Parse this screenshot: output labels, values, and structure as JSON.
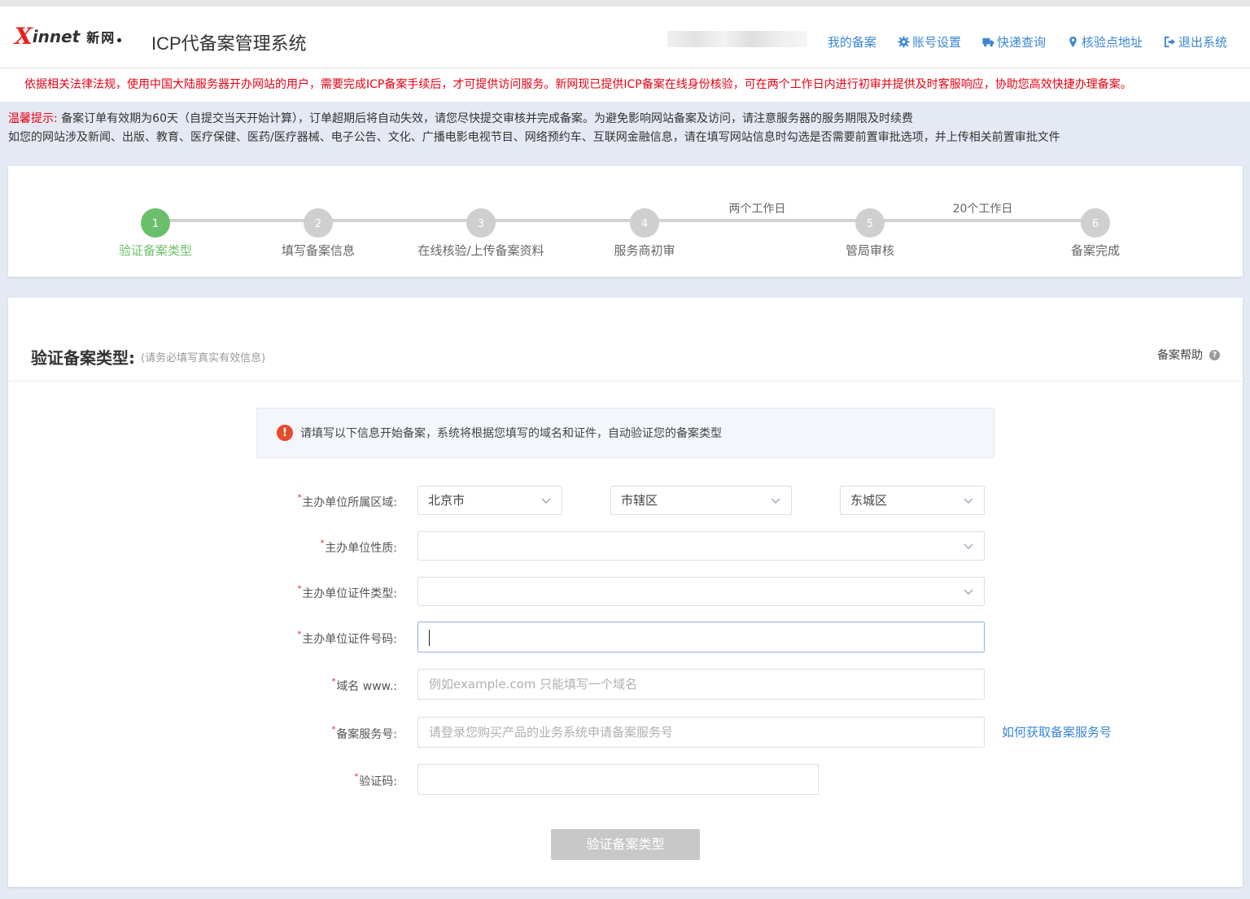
{
  "header": {
    "logo_x": "X",
    "logo_rest": "innet",
    "logo_cn": "新网",
    "title": "ICP代备案管理系统",
    "nav": [
      {
        "label": "我的备案",
        "icon": "none"
      },
      {
        "label": "账号设置",
        "icon": "gear-icon"
      },
      {
        "label": "快递查询",
        "icon": "truck-icon"
      },
      {
        "label": "核验点地址",
        "icon": "map-pin-icon"
      },
      {
        "label": "退出系统",
        "icon": "logout-icon"
      }
    ]
  },
  "notice": "依据相关法律法规，使用中国大陆服务器开办网站的用户，需要完成ICP备案手续后，才可提供访问服务。新网现已提供ICP备案在线身份核验，可在两个工作日内进行初审并提供及时客服响应，协助您高效快捷办理备案。",
  "tips": {
    "label": "温馨提示:",
    "line1": "备案订单有效期为60天（自提交当天开始计算），订单超期后将自动失效，请您尽快提交审核并完成备案。为避免影响网站备案及访问，请注意服务器的服务期限及时续费",
    "line2": "如您的网站涉及新闻、出版、教育、医疗保健、医药/医疗器械、电子公告、文化、广播电影电视节目、网络预约车、互联网金融信息，请在填写网站信息时勾选是否需要前置审批选项，并上传相关前置审批文件"
  },
  "steps": {
    "items": [
      {
        "num": "1",
        "label": "验证备案类型",
        "active": true
      },
      {
        "num": "2",
        "label": "填写备案信息",
        "active": false
      },
      {
        "num": "3",
        "label": "在线核验/上传备案资料",
        "active": false
      },
      {
        "num": "4",
        "label": "服务商初审",
        "active": false
      },
      {
        "num": "5",
        "label": "管局审核",
        "active": false
      },
      {
        "num": "6",
        "label": "备案完成",
        "active": false
      }
    ],
    "durations": [
      "两个工作日",
      "20个工作日"
    ],
    "active_color": "#6cbf6a",
    "inactive_color": "#cfcfcf"
  },
  "form": {
    "title": "验证备案类型:",
    "subtitle": "(请务必填写真实有效信息)",
    "help": "备案帮助",
    "alert": "请填写以下信息开始备案，系统将根据您填写的域名和证件，自动验证您的备案类型",
    "region_label": "主办单位所属区域:",
    "province": "北京市",
    "city": "市辖区",
    "district": "东城区",
    "nature_label": "主办单位性质:",
    "nature_value": "",
    "cert_type_label": "主办单位证件类型:",
    "cert_type_value": "",
    "cert_no_label": "主办单位证件号码:",
    "cert_no_value": "",
    "domain_label": "域名 www.:",
    "domain_placeholder": "例如example.com 只能填写一个域名",
    "service_label": "备案服务号:",
    "service_placeholder": "请登录您购买产品的业务系统申请备案服务号",
    "service_link": "如何获取备案服务号",
    "captcha_label": "验证码:",
    "captcha_value": "",
    "submit": "验证备案类型"
  }
}
